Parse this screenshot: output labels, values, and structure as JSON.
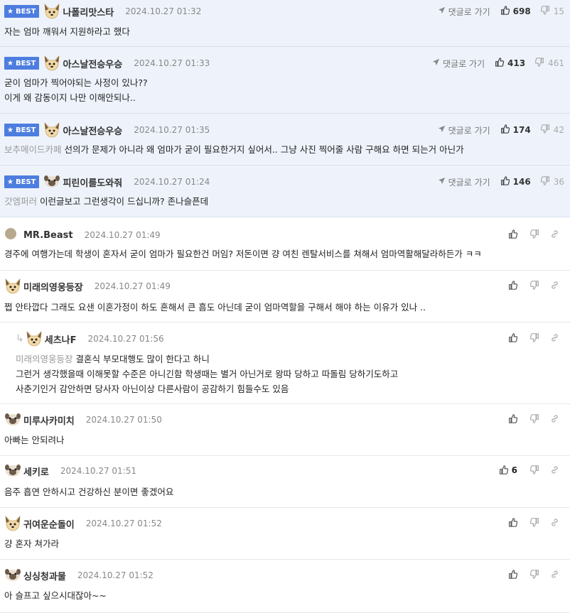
{
  "comments": [
    {
      "best": true,
      "badge": "BEST",
      "avatar": "dog",
      "nick": "나폴리맛스타",
      "date": "2024.10.27 01:32",
      "goto": "댓글로 가기",
      "up": "698",
      "down": "15",
      "mention": "",
      "lines": [
        "자는 엄마 깨워서 지원하라고 했다"
      ]
    },
    {
      "best": true,
      "badge": "BEST",
      "avatar": "dog",
      "nick": "아스날전승우승",
      "date": "2024.10.27 01:33",
      "goto": "댓글로 가기",
      "up": "413",
      "down": "461",
      "mention": "",
      "lines": [
        "굳이 엄마가 찍어야되는 사정이 있나??",
        "이게 왜 감동이지 나만 이해안되나.."
      ]
    },
    {
      "best": true,
      "badge": "BEST",
      "avatar": "dog",
      "nick": "아스날전승우승",
      "date": "2024.10.27 01:35",
      "goto": "댓글로 가기",
      "up": "174",
      "down": "42",
      "mention": "보추메이드카페",
      "lines": [
        "선의가 문제가 아니라 왜 엄마가 굳이 필요한거지 싶어서.. 그냥 사진 찍어줄 사람 구해요 하면 되는거 아닌가"
      ]
    },
    {
      "best": true,
      "badge": "BEST",
      "avatar": "pug",
      "nick": "피린이를도와줘",
      "date": "2024.10.27 01:24",
      "goto": "댓글로 가기",
      "up": "146",
      "down": "36",
      "mention": "갓엠퍼러",
      "lines": [
        "이런글보고 그런생각이 드십니까? 존나슬픈데"
      ]
    },
    {
      "best": false,
      "avatar": "dot",
      "nick": "MR.Beast",
      "date": "2024.10.27 01:49",
      "up": "",
      "mention": "",
      "lines": [
        "경주에 여행가는데 학생이 혼자서 굳이 엄마가 필요한건 머임? 저돈이면 걍 여친 렌탈서비스를 쳐해서 엄마역활해달라하든가 ㅋㅋ"
      ]
    },
    {
      "best": false,
      "avatar": "dog",
      "nick": "미래의영웅등장",
      "date": "2024.10.27 01:49",
      "up": "",
      "mention": "",
      "lines": [
        "쩝 안타깝다 그래도 요샌 이혼가정이 하도 흔해서 큰 흠도 아닌데 굳이 엄마역할을 구해서 해야 하는 이유가 있나 .."
      ]
    },
    {
      "best": false,
      "reply": true,
      "avatar": "dog",
      "nick": "세츠나F",
      "date": "2024.10.27 01:56",
      "up": "",
      "mention": "미래의영웅등장",
      "lines": [
        "결혼식 부모대행도 많이 한다고 하니",
        "그런거 생각했을때 이해못할 수준은 아니긴함 학생때는 별거 아닌거로 왕따 당하고 따돌림 당하기도하고",
        "사춘기인거 감안하면 당사자 아닌이상 다른사람이 공감하기 힘들수도 있음"
      ]
    },
    {
      "best": false,
      "avatar": "pug",
      "nick": "미루사카미치",
      "date": "2024.10.27 01:50",
      "up": "",
      "mention": "",
      "lines": [
        "아빠는 안되려나"
      ]
    },
    {
      "best": false,
      "avatar": "pug",
      "nick": "세키로",
      "date": "2024.10.27 01:51",
      "up": "6",
      "mention": "",
      "lines": [
        "음주 흡연 안하시고 건강하신 분이면 좋겠어요"
      ]
    },
    {
      "best": false,
      "avatar": "dog",
      "nick": "귀여운순돌이",
      "date": "2024.10.27 01:52",
      "up": "",
      "mention": "",
      "lines": [
        "걍 혼자 쳐가라"
      ]
    },
    {
      "best": false,
      "avatar": "pug",
      "nick": "싱싱청과물",
      "date": "2024.10.27 01:52",
      "up": "",
      "mention": "",
      "lines": [
        "아 슬프고 싶으시대잖아~~"
      ]
    }
  ],
  "icons": {
    "thumbs_up": "thumbs-up-icon",
    "thumbs_down": "thumbs-down-icon",
    "link": "link-icon",
    "arrow": "reply-arrow-icon",
    "star": "star-icon"
  },
  "colors": {
    "best_bg": "#eef3fb",
    "badge": "#4d7ddf",
    "mention": "#999999"
  }
}
